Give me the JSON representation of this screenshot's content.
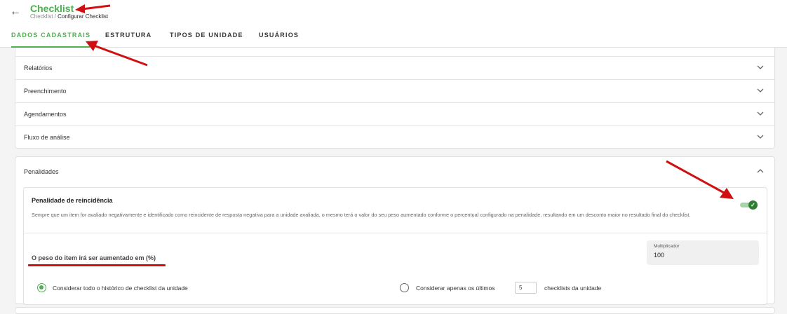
{
  "header": {
    "back_icon": "arrow-left-icon",
    "title": "Checklist",
    "breadcrumb": {
      "parent": "Checklist",
      "separator": " / ",
      "current": "Configurar Checklist"
    }
  },
  "tabs": [
    {
      "label": "DADOS CADASTRAIS",
      "active": true
    },
    {
      "label": "ESTRUTURA",
      "active": false
    },
    {
      "label": "TIPOS DE UNIDADE",
      "active": false
    },
    {
      "label": "USUÁRIOS",
      "active": false
    }
  ],
  "sections": [
    {
      "label": "Relatórios"
    },
    {
      "label": "Preenchimento"
    },
    {
      "label": "Agendamentos"
    },
    {
      "label": "Fluxo de análise"
    }
  ],
  "penalties": {
    "section_label": "Penalidades",
    "recurrence": {
      "title": "Penalidade de reincidência",
      "description": "Sempre que um item for avaliado negativamente e identificado como reincidente de resposta negativa para a unidade avaliada, o mesmo terá o valor do seu peso aumentado conforme o percentual configurado na penalidade, resultando em um desconto maior no resultado final do checklist.",
      "enabled": true,
      "weight_label": "O peso do item irá ser aumentado em (%)",
      "multiplier_label": "Multiplicador",
      "multiplier_value": "100",
      "option_all": "Considerar todo o histórico de checklist da unidade",
      "option_last_prefix": "Considerar apenas os últimos",
      "option_last_value": "5",
      "option_last_suffix": "checklists da unidade",
      "selected_option": "all"
    }
  },
  "colors": {
    "accent": "#4caf50",
    "annotation": "#d01010"
  }
}
